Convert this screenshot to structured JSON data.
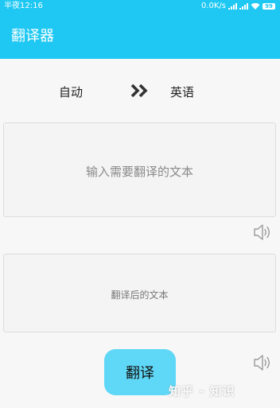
{
  "status_bar": {
    "time": "半夜12:16",
    "network_speed": "0.0K/s",
    "battery": "99"
  },
  "app_bar": {
    "title": "翻译器"
  },
  "language": {
    "from": "自动",
    "to": "英语",
    "switch_icon": "double-chevron-right-icon"
  },
  "input": {
    "placeholder": "输入需要翻译的文本",
    "value": ""
  },
  "output": {
    "text": "翻译后的文本"
  },
  "speaker_icon": "volume-speaker-icon",
  "translate_button": {
    "label": "翻译"
  },
  "watermark": "知乎 - 知识",
  "colors": {
    "primary": "#1ec8f3",
    "button": "#5fd8f7",
    "background": "#f7f7f7",
    "box_background": "#f4f4f4"
  }
}
